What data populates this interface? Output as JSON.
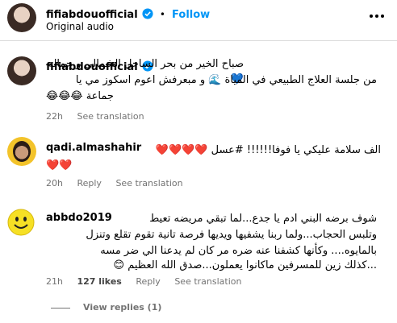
{
  "header": {
    "username": "fifiabdouofficial",
    "dot": "•",
    "follow": "Follow",
    "subtitle": "Original audio",
    "more_icon": "more-horizontal-icon"
  },
  "caption": {
    "username": "fifiabdouofficial",
    "line1": "صباح الخير من بحر الساحل الشمالي و جماله 💙",
    "line2": "من جلسة العلاج الطبيعي في المياة 🌊 و مبعرفش اعوم اسكوز مي يا",
    "line3": "جماعة 😂😂😂",
    "time": "22h",
    "see_translation": "See translation"
  },
  "comments": [
    {
      "username": "qadi.almashahir",
      "line1": "الف سلامة عليكي يا فوفا!!!!!! #عسل ❤️❤️❤️❤️",
      "line2": "❤️❤️",
      "time": "20h",
      "reply": "Reply",
      "see_translation": "See translation"
    },
    {
      "username": "abbdo2019",
      "line1": "شوف برضه البني ادم يا جدع...لما تبقي مريضه تعيط",
      "line2": "وتلبس الحجاب...ولما ربنا يشفيها ويديها فرصة تانية تقوم تقلع وتنزل",
      "line3": "بالمايوه.... وكأنها كشفنا عنه ضره مر كان لم يدعنا الي ضر مسه",
      "line4": "...كذلك زين للمسرفين ماكانوا يعملون...صدق الله العظيم 😊",
      "time": "21h",
      "likes": "127 likes",
      "reply": "Reply",
      "see_translation": "See translation",
      "view_replies": "View replies (1)"
    }
  ],
  "colors": {
    "accent": "#0095f6",
    "verified": "#0095f6",
    "muted": "#737373",
    "divider": "#dbdbdb"
  }
}
